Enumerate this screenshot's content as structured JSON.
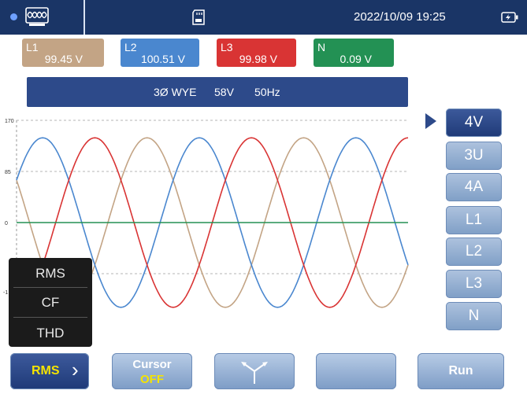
{
  "status_bar": {
    "datetime": "2022/10/09 19:25",
    "icons": [
      "status-dot-icon",
      "oscilloscope-logo-icon",
      "sd-card-icon",
      "battery-charging-icon"
    ]
  },
  "channels": [
    {
      "name": "L1",
      "value": "99.45  V",
      "color": "#c3a485"
    },
    {
      "name": "L2",
      "value": "100.51  V",
      "color": "#4a87cf"
    },
    {
      "name": "L3",
      "value": "99.98  V",
      "color": "#d93434"
    },
    {
      "name": "N",
      "value": "0.09  V",
      "color": "#239154"
    }
  ],
  "info_bar": {
    "config": "3Ø WYE",
    "voltage": "58V",
    "frequency": "50Hz"
  },
  "chart_data": {
    "type": "line",
    "y_ticks": [
      "170",
      "85",
      "0",
      "-1"
    ],
    "ylim": [
      -170,
      170
    ],
    "x_range_deg": [
      0,
      900
    ],
    "series": [
      {
        "name": "L1",
        "color": "#c3a485",
        "amplitude": 141,
        "phase_deg": -60
      },
      {
        "name": "L2",
        "color": "#4a87cf",
        "amplitude": 141,
        "phase_deg": 60
      },
      {
        "name": "L3",
        "color": "#d93434",
        "amplitude": 141,
        "phase_deg": 180
      },
      {
        "name": "N",
        "color": "#239154",
        "amplitude": 0,
        "phase_deg": 0
      }
    ],
    "grid": true
  },
  "side_buttons": [
    {
      "label": "4V",
      "active": true
    },
    {
      "label": "3U",
      "active": false
    },
    {
      "label": "4A",
      "active": false
    },
    {
      "label": "L1",
      "active": false
    },
    {
      "label": "L2",
      "active": false
    },
    {
      "label": "L3",
      "active": false
    },
    {
      "label": "N",
      "active": false
    }
  ],
  "popup_menu": [
    "RMS",
    "CF",
    "THD"
  ],
  "bottom_buttons": {
    "rms": "RMS",
    "rms_chevron": "›",
    "cursor_label": "Cursor",
    "cursor_state": "OFF",
    "phasor_icon": "phasor-icon",
    "blank": "",
    "run": "Run",
    "highlight_color": "#f5e400"
  }
}
